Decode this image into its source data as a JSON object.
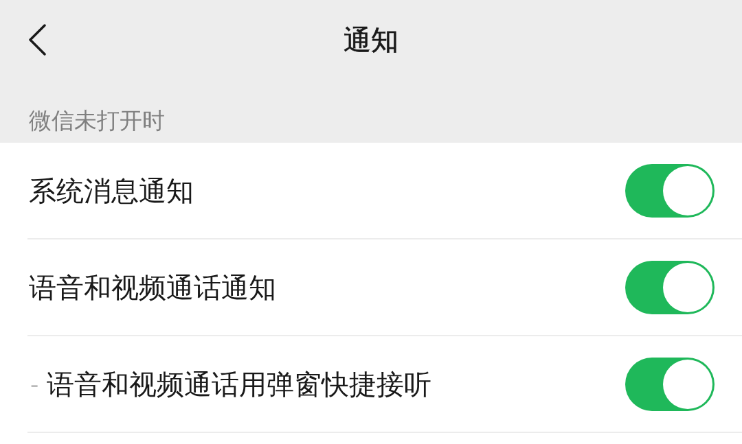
{
  "header": {
    "title": "通知"
  },
  "section": {
    "label": "微信未打开时"
  },
  "settings": [
    {
      "label": "系统消息通知",
      "on": true
    },
    {
      "label": "语音和视频通话通知",
      "on": true
    },
    {
      "prefix": "-",
      "label": "语音和视频通话用弹窗快捷接听",
      "on": true
    }
  ]
}
